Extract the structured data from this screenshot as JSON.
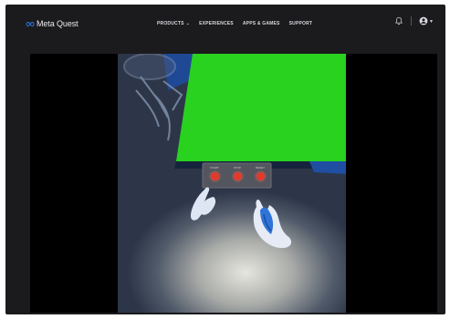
{
  "brand": {
    "name": "Meta Quest"
  },
  "nav": {
    "items": [
      {
        "label": "PRODUCTS",
        "has_dropdown": true
      },
      {
        "label": "EXPERIENCES",
        "has_dropdown": false
      },
      {
        "label": "APPS & GAMES",
        "has_dropdown": false
      },
      {
        "label": "SUPPORT",
        "has_dropdown": false
      }
    ]
  },
  "header_icons": [
    "bell-icon",
    "account-icon",
    "chevron-down-icon"
  ],
  "video": {
    "panel_buttons": [
      {
        "label": "START",
        "color": "#e23a2a"
      },
      {
        "label": "STOP",
        "color": "#e23a2a"
      },
      {
        "label": "RESET",
        "color": "#e23a2a"
      }
    ]
  },
  "colors": {
    "page_bg": "#ffffff",
    "frame_bg": "#1b1b1d",
    "video_bg": "#000000",
    "screen_green": "#28d21f",
    "hand_blue": "#2f74d6"
  }
}
